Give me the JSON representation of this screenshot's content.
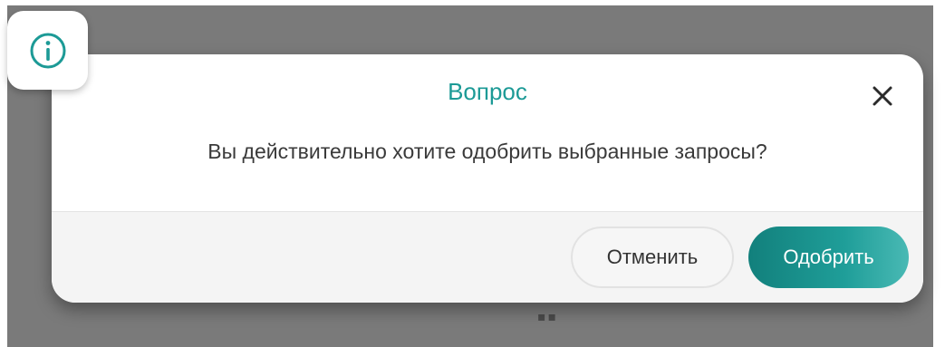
{
  "dialog": {
    "title": "Вопрос",
    "message": "Вы действительно хотите одобрить выбранные запросы?",
    "cancel_label": "Отменить",
    "approve_label": "Одобрить",
    "close_icon": "close-icon",
    "info_icon": "info-icon"
  },
  "background": {
    "mark": "▪▪"
  },
  "colors": {
    "accent": "#1c9a96",
    "approve_button": "#12807c",
    "overlay": "#7a7a7a"
  }
}
